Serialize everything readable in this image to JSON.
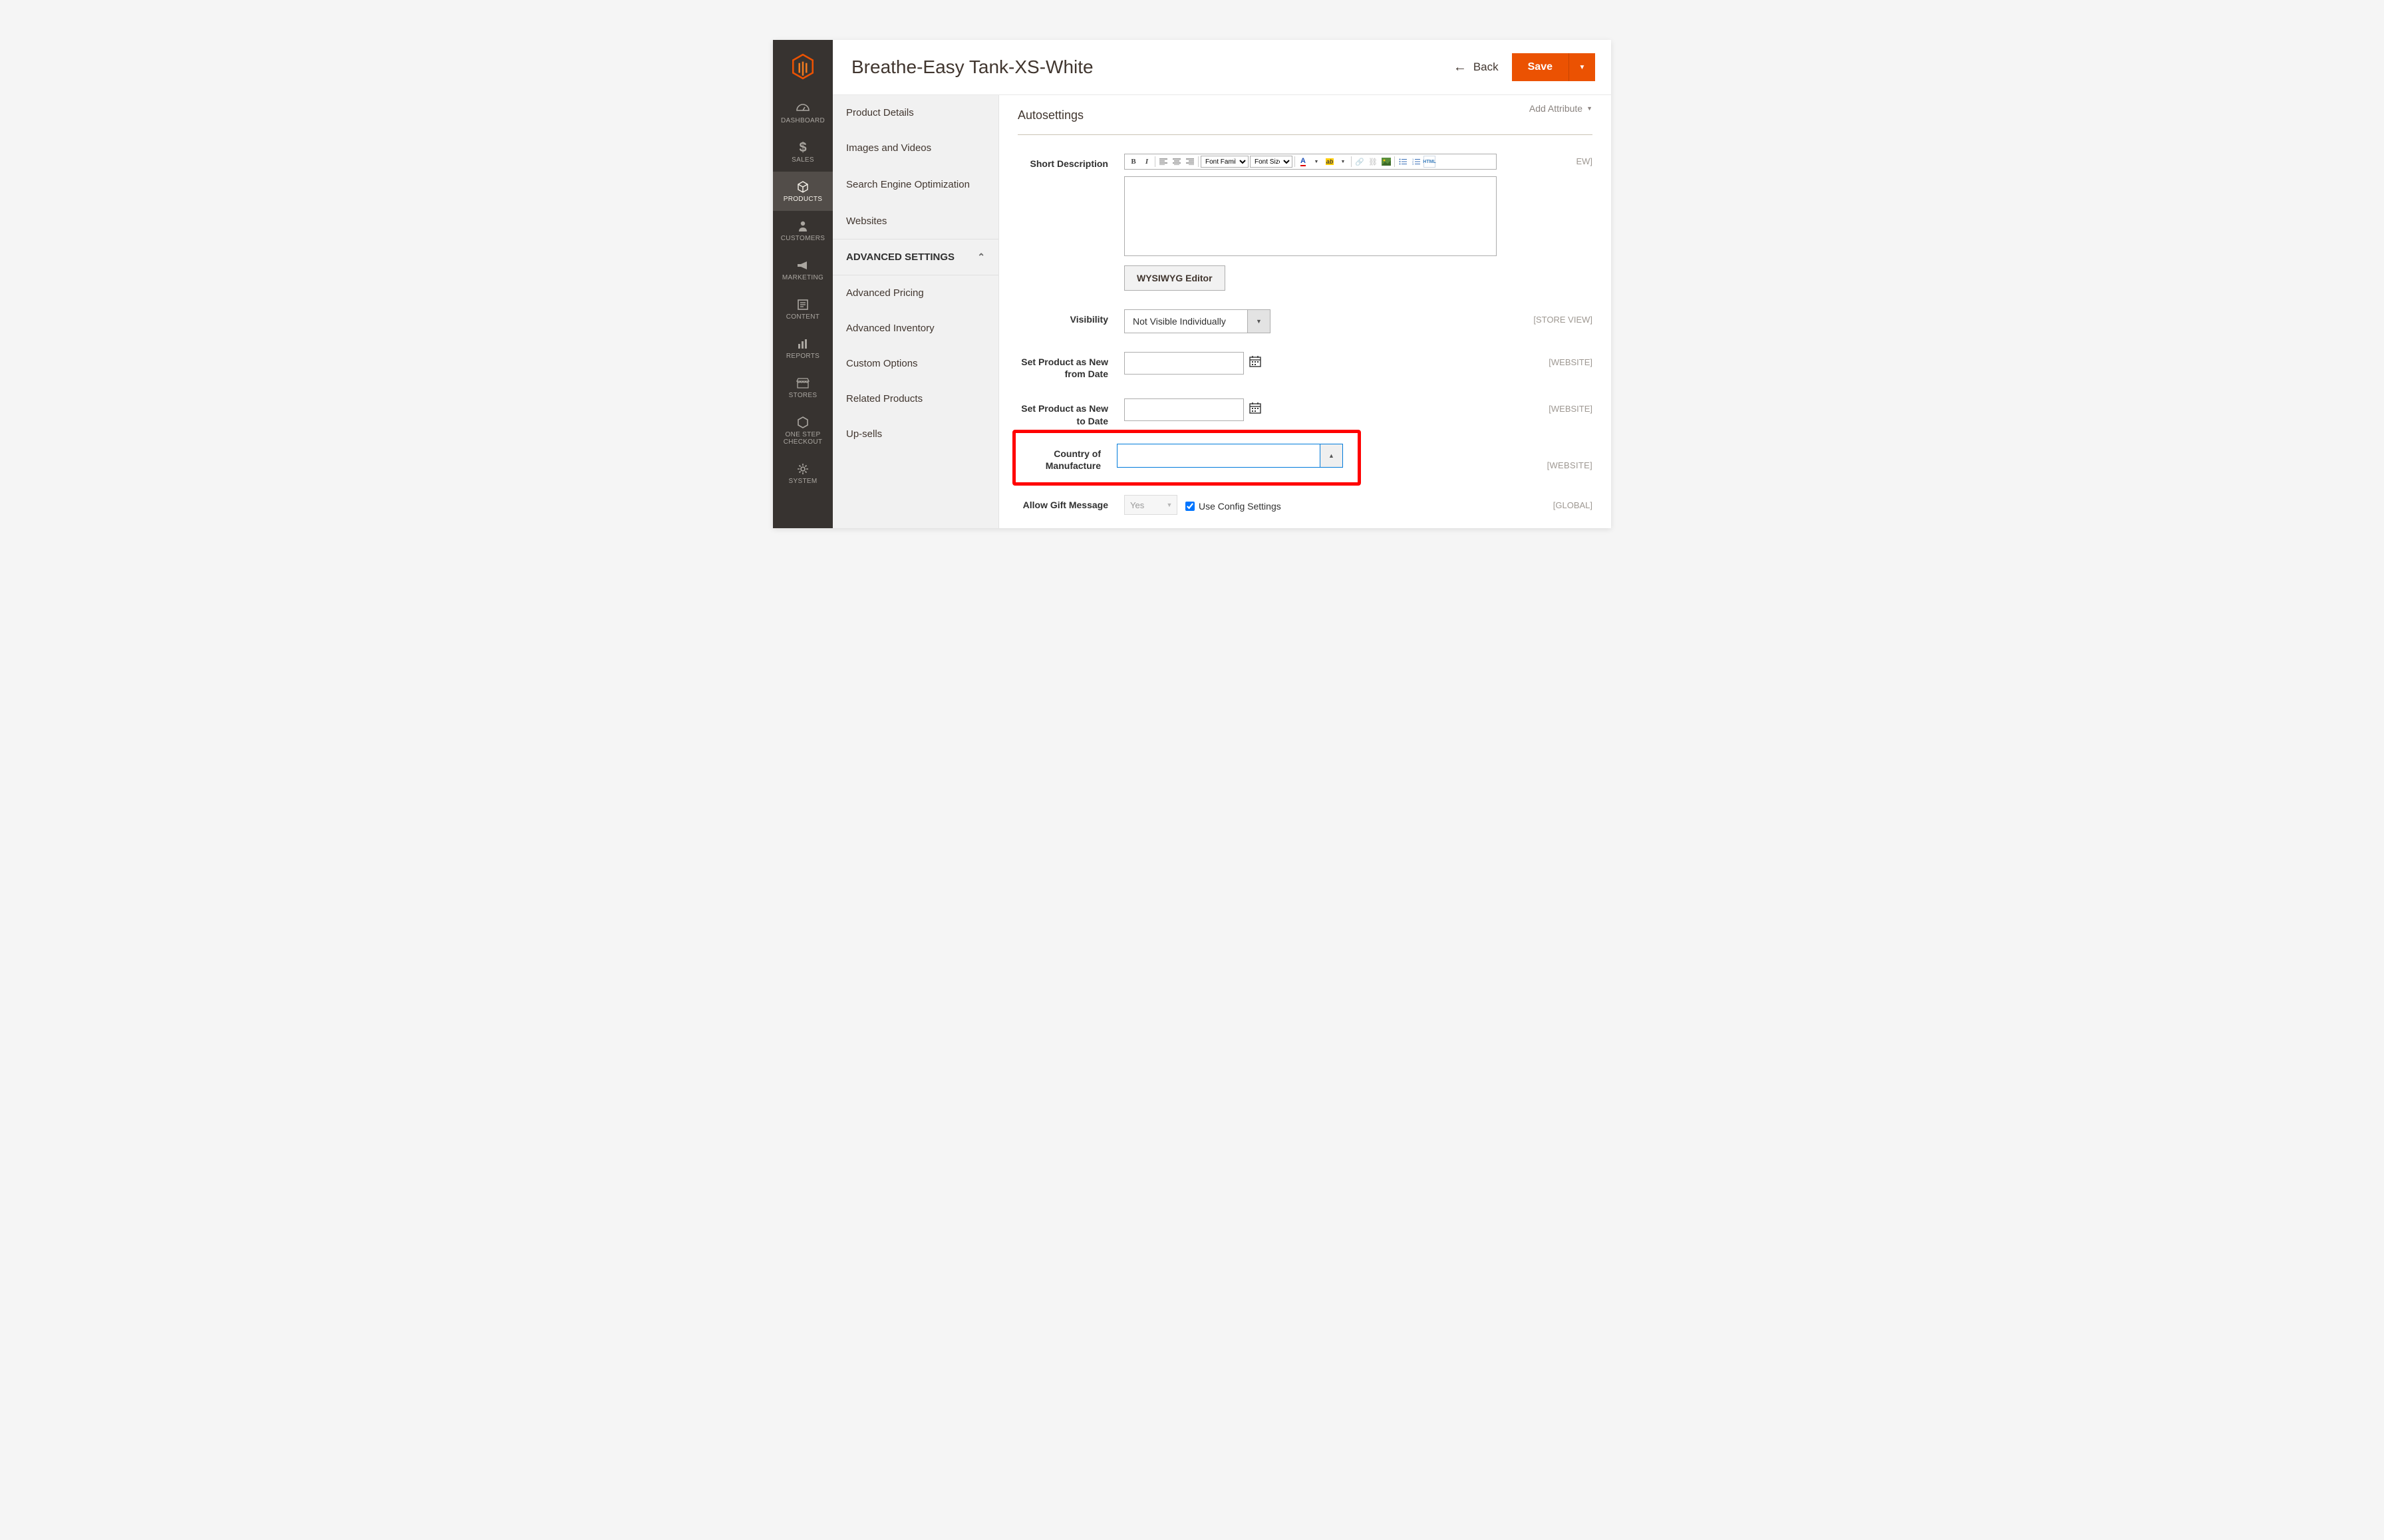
{
  "nav": {
    "items": [
      {
        "label": "DASHBOARD",
        "icon": "dashboard"
      },
      {
        "label": "SALES",
        "icon": "dollar"
      },
      {
        "label": "PRODUCTS",
        "icon": "cube"
      },
      {
        "label": "CUSTOMERS",
        "icon": "person"
      },
      {
        "label": "MARKETING",
        "icon": "megaphone"
      },
      {
        "label": "CONTENT",
        "icon": "page"
      },
      {
        "label": "REPORTS",
        "icon": "bars"
      },
      {
        "label": "STORES",
        "icon": "storefront"
      },
      {
        "label": "ONE STEP CHECKOUT",
        "icon": "hex"
      },
      {
        "label": "SYSTEM",
        "icon": "gear"
      }
    ]
  },
  "header": {
    "title": "Breathe-Easy Tank-XS-White",
    "back": "Back",
    "save": "Save"
  },
  "sidebar": {
    "basic": [
      "Product Details",
      "Images and Videos",
      "Search Engine Optimization",
      "Websites"
    ],
    "advanced_heading": "ADVANCED SETTINGS",
    "advanced": [
      "Advanced Pricing",
      "Advanced Inventory",
      "Custom Options",
      "Related Products",
      "Up-sells"
    ]
  },
  "content": {
    "add_attribute": "Add Attribute",
    "section_title": "Autosettings",
    "short_desc_label": "Short Description",
    "font_family": "Font Family",
    "font_size": "Font Size",
    "wysiwyg_btn": "WYSIWYG Editor",
    "visibility_label": "Visibility",
    "visibility_value": "Not Visible Individually",
    "new_from_label": "Set Product as New from Date",
    "new_to_label": "Set Product as New to Date",
    "country_label": "Country of Manufacture",
    "country_value": "",
    "gift_label": "Allow Gift Message",
    "gift_value": "Yes",
    "use_config": "Use Config Settings",
    "scope_store_view": "[STORE VIEW]",
    "scope_website": "[WEBSITE]",
    "scope_global": "[GLOBAL]",
    "scope_ew": "EW]"
  }
}
